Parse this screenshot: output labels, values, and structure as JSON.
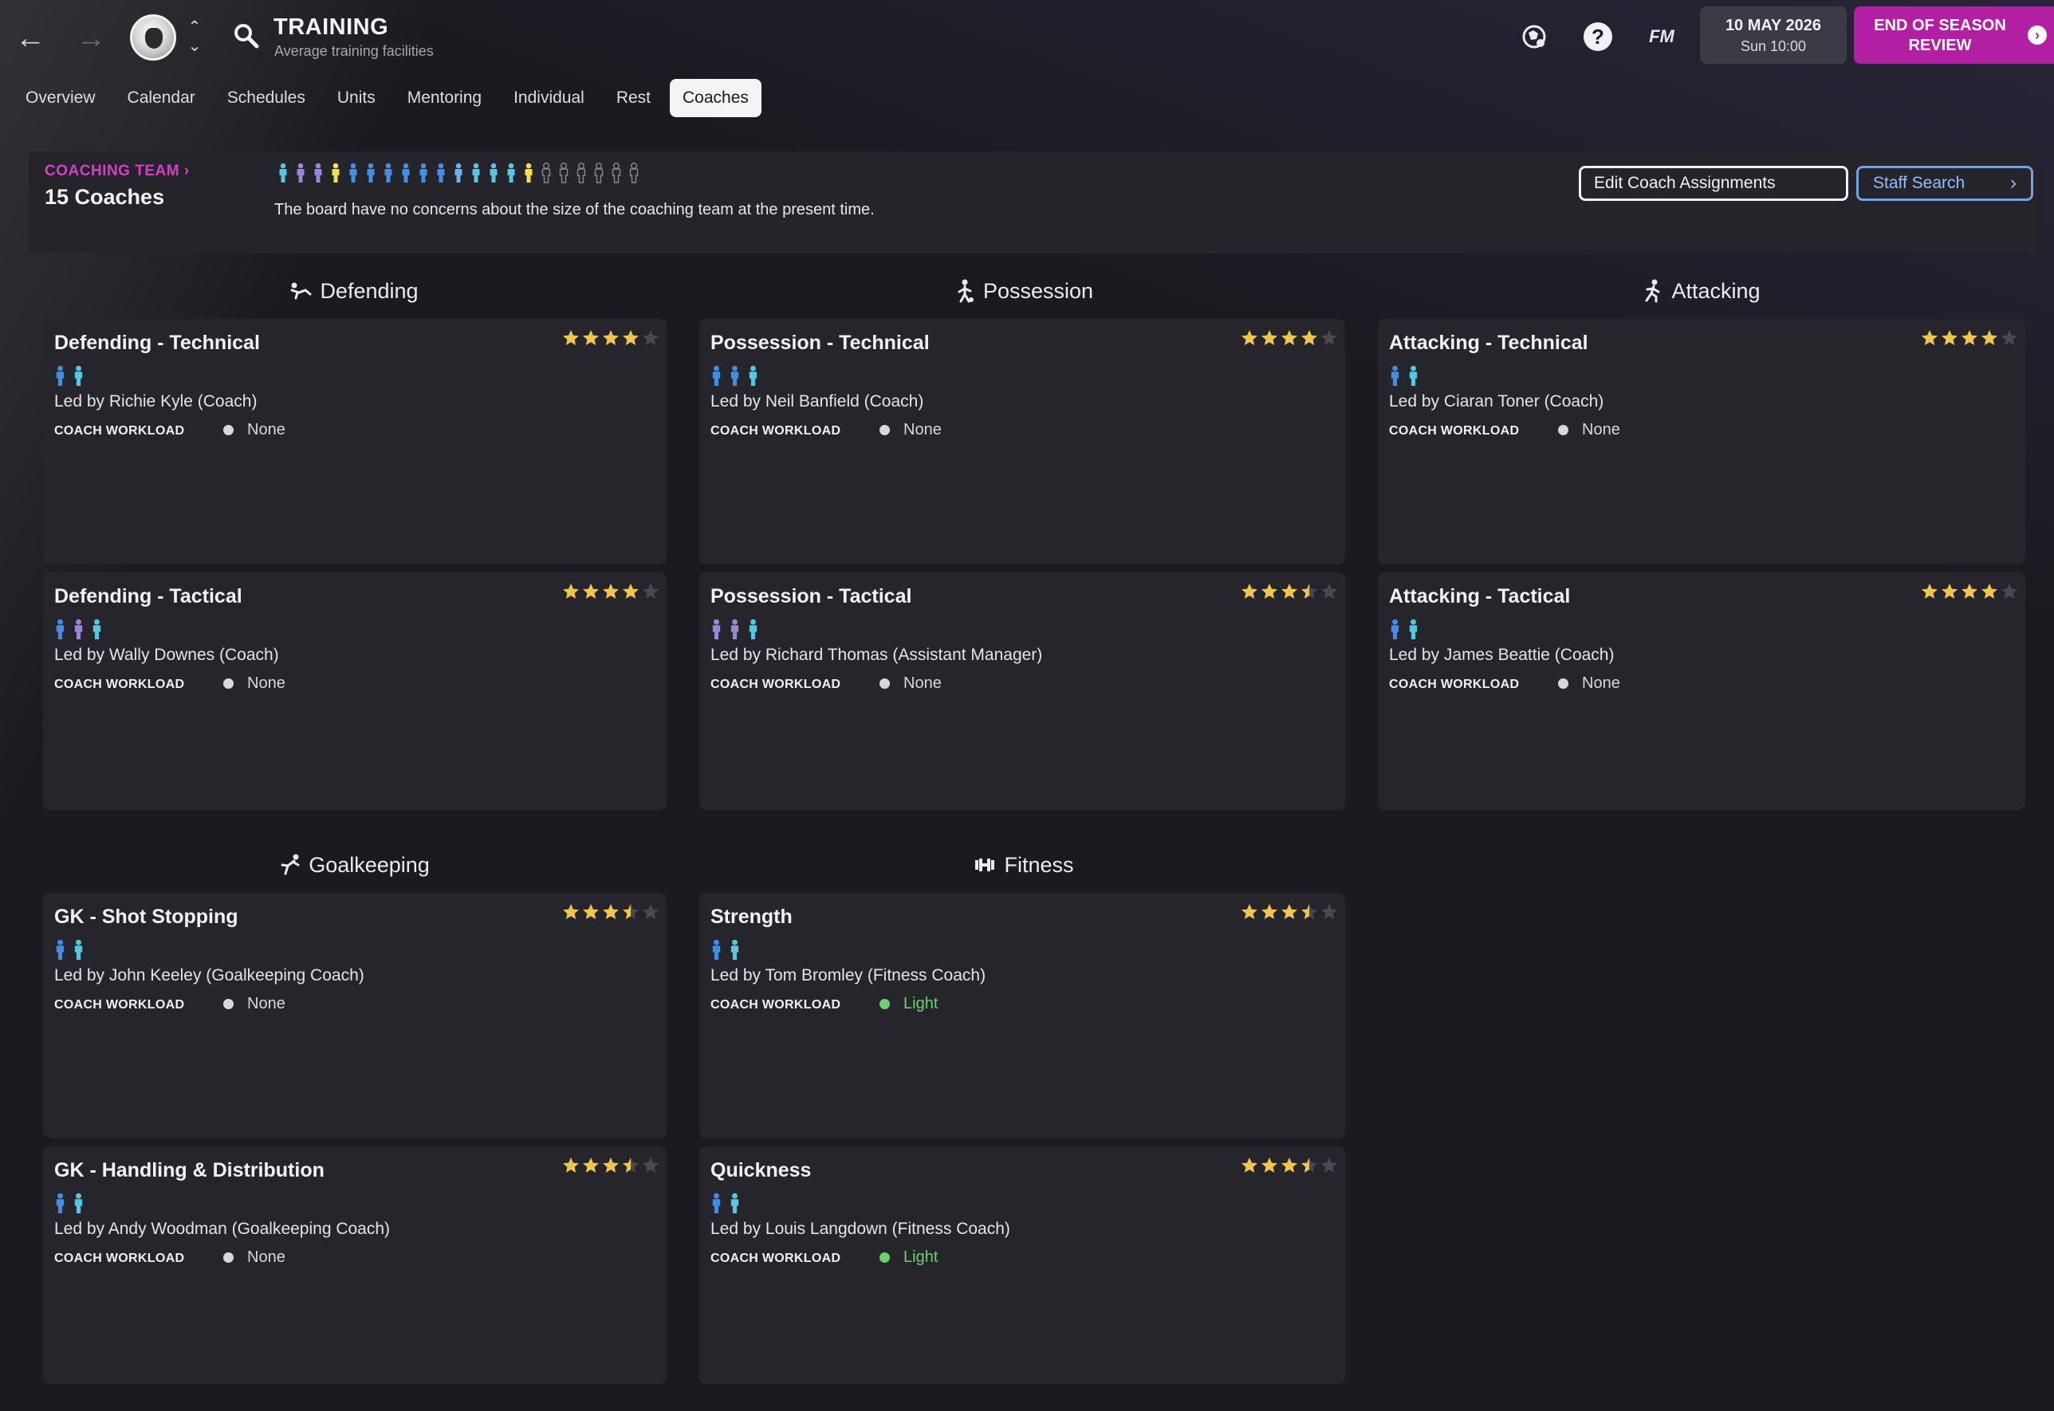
{
  "header": {
    "title": "TRAINING",
    "subtitle": "Average training facilities",
    "fm_label": "FM",
    "help_label": "?",
    "date": "10 MAY 2026",
    "time": "Sun 10:00",
    "end_season_label": "END OF SEASON REVIEW"
  },
  "tabs": [
    "Overview",
    "Calendar",
    "Schedules",
    "Units",
    "Mentoring",
    "Individual",
    "Rest",
    "Coaches"
  ],
  "active_tab": "Coaches",
  "coaching_team": {
    "label": "COACHING TEAM",
    "count": "15 Coaches",
    "message": "The board have no concerns about the size of the coaching team at the present time.",
    "figures": [
      "cyan",
      "purple",
      "purple",
      "yellow",
      "blue",
      "blue",
      "blue",
      "blue",
      "blue",
      "blue",
      "lightblue",
      "cyan",
      "cyan",
      "cyan",
      "yellow",
      "empty",
      "empty",
      "empty",
      "empty",
      "empty",
      "empty"
    ],
    "edit_button": "Edit Coach Assignments",
    "staff_search_button": "Staff Search"
  },
  "colors": {
    "accent": "#b21fa3",
    "coaching_label": "#d43fc6",
    "star": "#f1c54a",
    "workload_none": "#d8d6de",
    "workload_light": "#6ad36a",
    "fig_blue": "#3f8fe8",
    "fig_cyan": "#56c7e0",
    "fig_lightblue": "#6cb0f0",
    "fig_purple": "#9a86d8",
    "fig_yellow": "#f2e14c"
  },
  "sections": {
    "defending": "Defending",
    "possession": "Possession",
    "attacking": "Attacking",
    "goalkeeping": "Goalkeeping",
    "fitness": "Fitness"
  },
  "workload_label": "COACH WORKLOAD",
  "cards": {
    "def_tech": {
      "title": "Defending - Technical",
      "stars": 4,
      "figures": [
        "blue",
        "cyan"
      ],
      "led_by": "Led by Richie Kyle (Coach)",
      "workload": "None"
    },
    "def_tac": {
      "title": "Defending - Tactical",
      "stars": 4,
      "figures": [
        "blue",
        "purple",
        "cyan"
      ],
      "led_by": "Led by Wally Downes (Coach)",
      "workload": "None"
    },
    "pos_tech": {
      "title": "Possession - Technical",
      "stars": 4,
      "figures": [
        "blue",
        "blue",
        "cyan"
      ],
      "led_by": "Led by Neil Banfield (Coach)",
      "workload": "None"
    },
    "pos_tac": {
      "title": "Possession - Tactical",
      "stars": 3.5,
      "figures": [
        "purple",
        "purple",
        "cyan"
      ],
      "led_by": "Led by Richard Thomas (Assistant Manager)",
      "workload": "None"
    },
    "att_tech": {
      "title": "Attacking - Technical",
      "stars": 4,
      "figures": [
        "blue",
        "cyan"
      ],
      "led_by": "Led by Ciaran Toner (Coach)",
      "workload": "None"
    },
    "att_tac": {
      "title": "Attacking - Tactical",
      "stars": 4,
      "figures": [
        "blue",
        "cyan"
      ],
      "led_by": "Led by James Beattie (Coach)",
      "workload": "None"
    },
    "gk_shot": {
      "title": "GK - Shot Stopping",
      "stars": 3.5,
      "figures": [
        "blue",
        "cyan"
      ],
      "led_by": "Led by John Keeley (Goalkeeping Coach)",
      "workload": "None"
    },
    "gk_hand": {
      "title": "GK - Handling & Distribution",
      "stars": 3.5,
      "figures": [
        "blue",
        "cyan"
      ],
      "led_by": "Led by Andy Woodman (Goalkeeping Coach)",
      "workload": "None"
    },
    "strength": {
      "title": "Strength",
      "stars": 3.5,
      "figures": [
        "blue",
        "cyan"
      ],
      "led_by": "Led by Tom Bromley (Fitness Coach)",
      "workload": "Light"
    },
    "quickness": {
      "title": "Quickness",
      "stars": 3.5,
      "figures": [
        "blue",
        "cyan"
      ],
      "led_by": "Led by Louis Langdown (Fitness Coach)",
      "workload": "Light"
    }
  }
}
